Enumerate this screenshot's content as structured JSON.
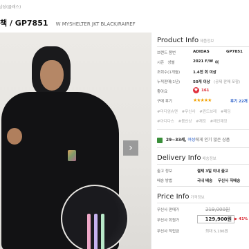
{
  "breadcrumb": "남성(클래스)",
  "product": {
    "name_prefix": "책 / GP7851",
    "subtitle": "W MYSHELTER JKT BLACK/RAIREF"
  },
  "gallery": {
    "next_arrow": "›"
  },
  "info": {
    "title": "Product Info",
    "title_sub": "제품정보",
    "rows": [
      {
        "key": "브랜드 품번",
        "v1": "ADIDAS",
        "v2": "GP7851"
      },
      {
        "key": "시즌",
        "sub": "성별",
        "v1": "2021 F/W",
        "v2": "여"
      },
      {
        "key": "조회수(1개월)",
        "v1": "1.4천 회 이상"
      },
      {
        "key": "누적판매(1년)",
        "v1": "50개 이상",
        "v2": "(공제 판매 포함)"
      },
      {
        "key": "좋아요",
        "v1": "161"
      },
      {
        "key": "구매 후기",
        "v1": "후기 22개"
      }
    ],
    "heart_icon": "heart-icon",
    "tags_line1": [
      "#미디엄슈맨",
      "#무신사",
      "#윈드브레",
      "#패딩"
    ],
    "tags_line2": [
      "#아디다스",
      "#봄신상",
      "#재킷",
      "#레인재킷"
    ]
  },
  "stats": {
    "age": "29~33세,",
    "gender": "여성",
    "text": "에게 인기 많은 상품"
  },
  "delivery": {
    "title": "Delivery Info",
    "title_sub": "배송정보",
    "rows": [
      {
        "key": "출고 정보",
        "v1": "결제 3일 이내 출고"
      },
      {
        "key": "배송 방법",
        "v1": "국내 배송",
        "v2": "무신사 직배송"
      }
    ]
  },
  "price": {
    "title": "Price Info",
    "title_sub": "가격정보",
    "rows": [
      {
        "key": "무신사 판매가",
        "value": "219,000원"
      },
      {
        "key": "무신사 회원가",
        "value": "129,900원",
        "extra": "▶ 41%"
      },
      {
        "key": "무신사 적립금",
        "value": "최대 5,196원"
      }
    ]
  },
  "colors": {
    "accent_red": "#d9232d",
    "accent_blue": "#2a5fc9"
  }
}
